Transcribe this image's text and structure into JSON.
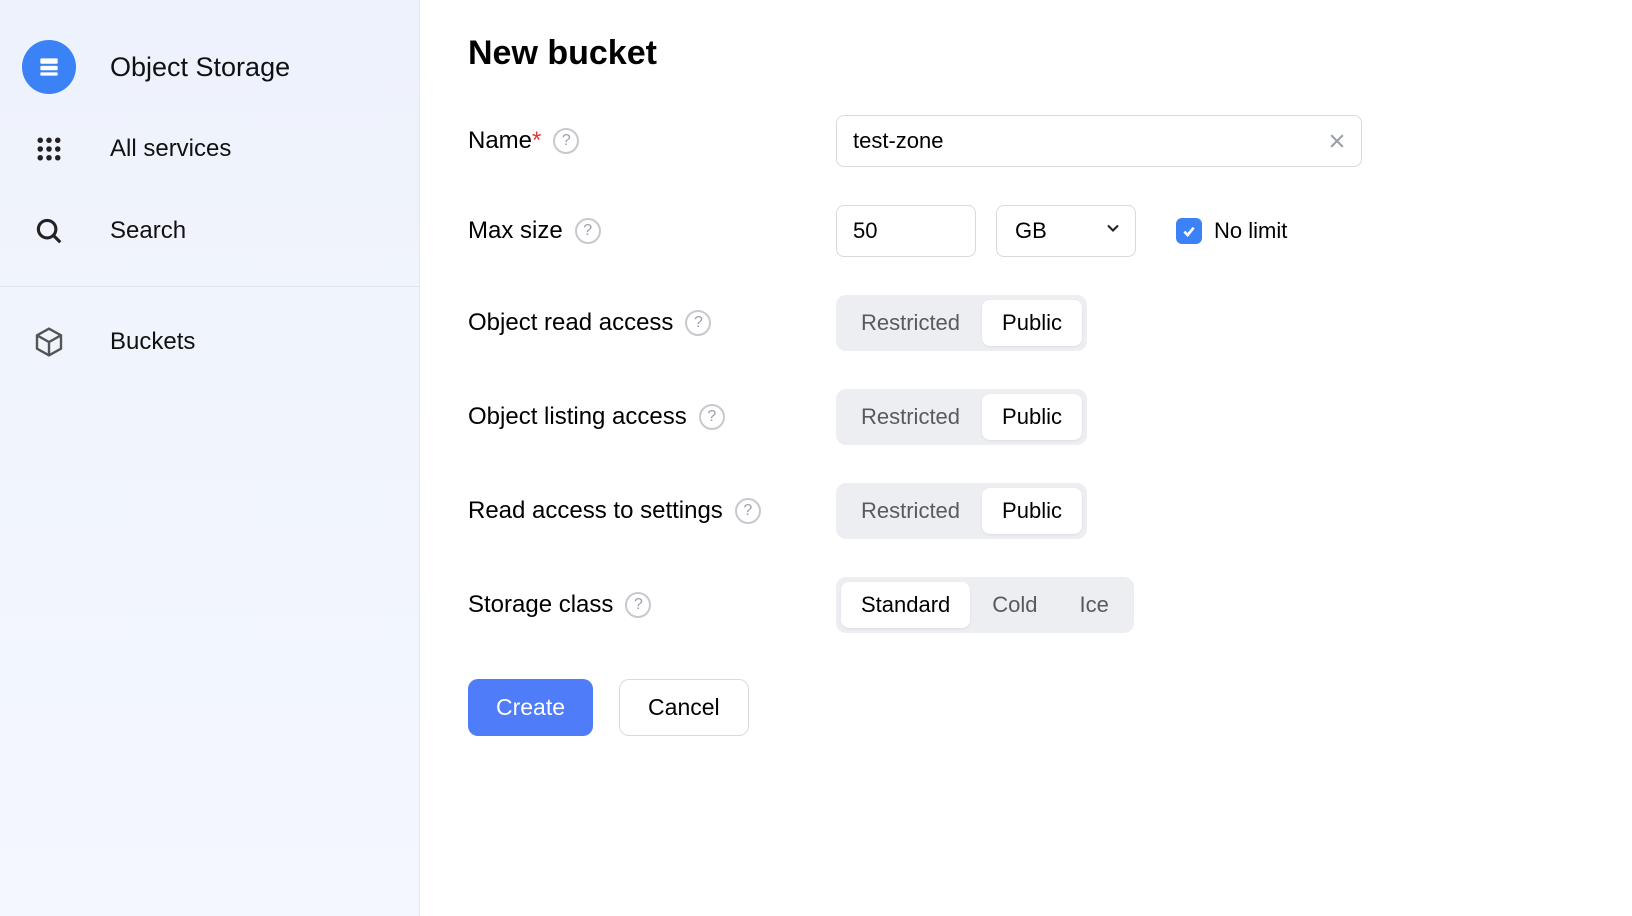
{
  "sidebar": {
    "head": "Object Storage",
    "all_services": "All services",
    "search": "Search",
    "buckets": "Buckets"
  },
  "title": "New bucket",
  "fields": {
    "name": {
      "label": "Name",
      "value": "test-zone"
    },
    "max_size": {
      "label": "Max size",
      "value": "50",
      "unit": "GB",
      "no_limit_label": "No limit",
      "no_limit_checked": true
    },
    "object_read": {
      "label": "Object read access",
      "options": [
        "Restricted",
        "Public"
      ],
      "selected": "Public"
    },
    "object_listing": {
      "label": "Object listing access",
      "options": [
        "Restricted",
        "Public"
      ],
      "selected": "Public"
    },
    "settings_read": {
      "label": "Read access to settings",
      "options": [
        "Restricted",
        "Public"
      ],
      "selected": "Public"
    },
    "storage_class": {
      "label": "Storage class",
      "options": [
        "Standard",
        "Cold",
        "Ice"
      ],
      "selected": "Standard"
    }
  },
  "actions": {
    "create": "Create",
    "cancel": "Cancel"
  }
}
